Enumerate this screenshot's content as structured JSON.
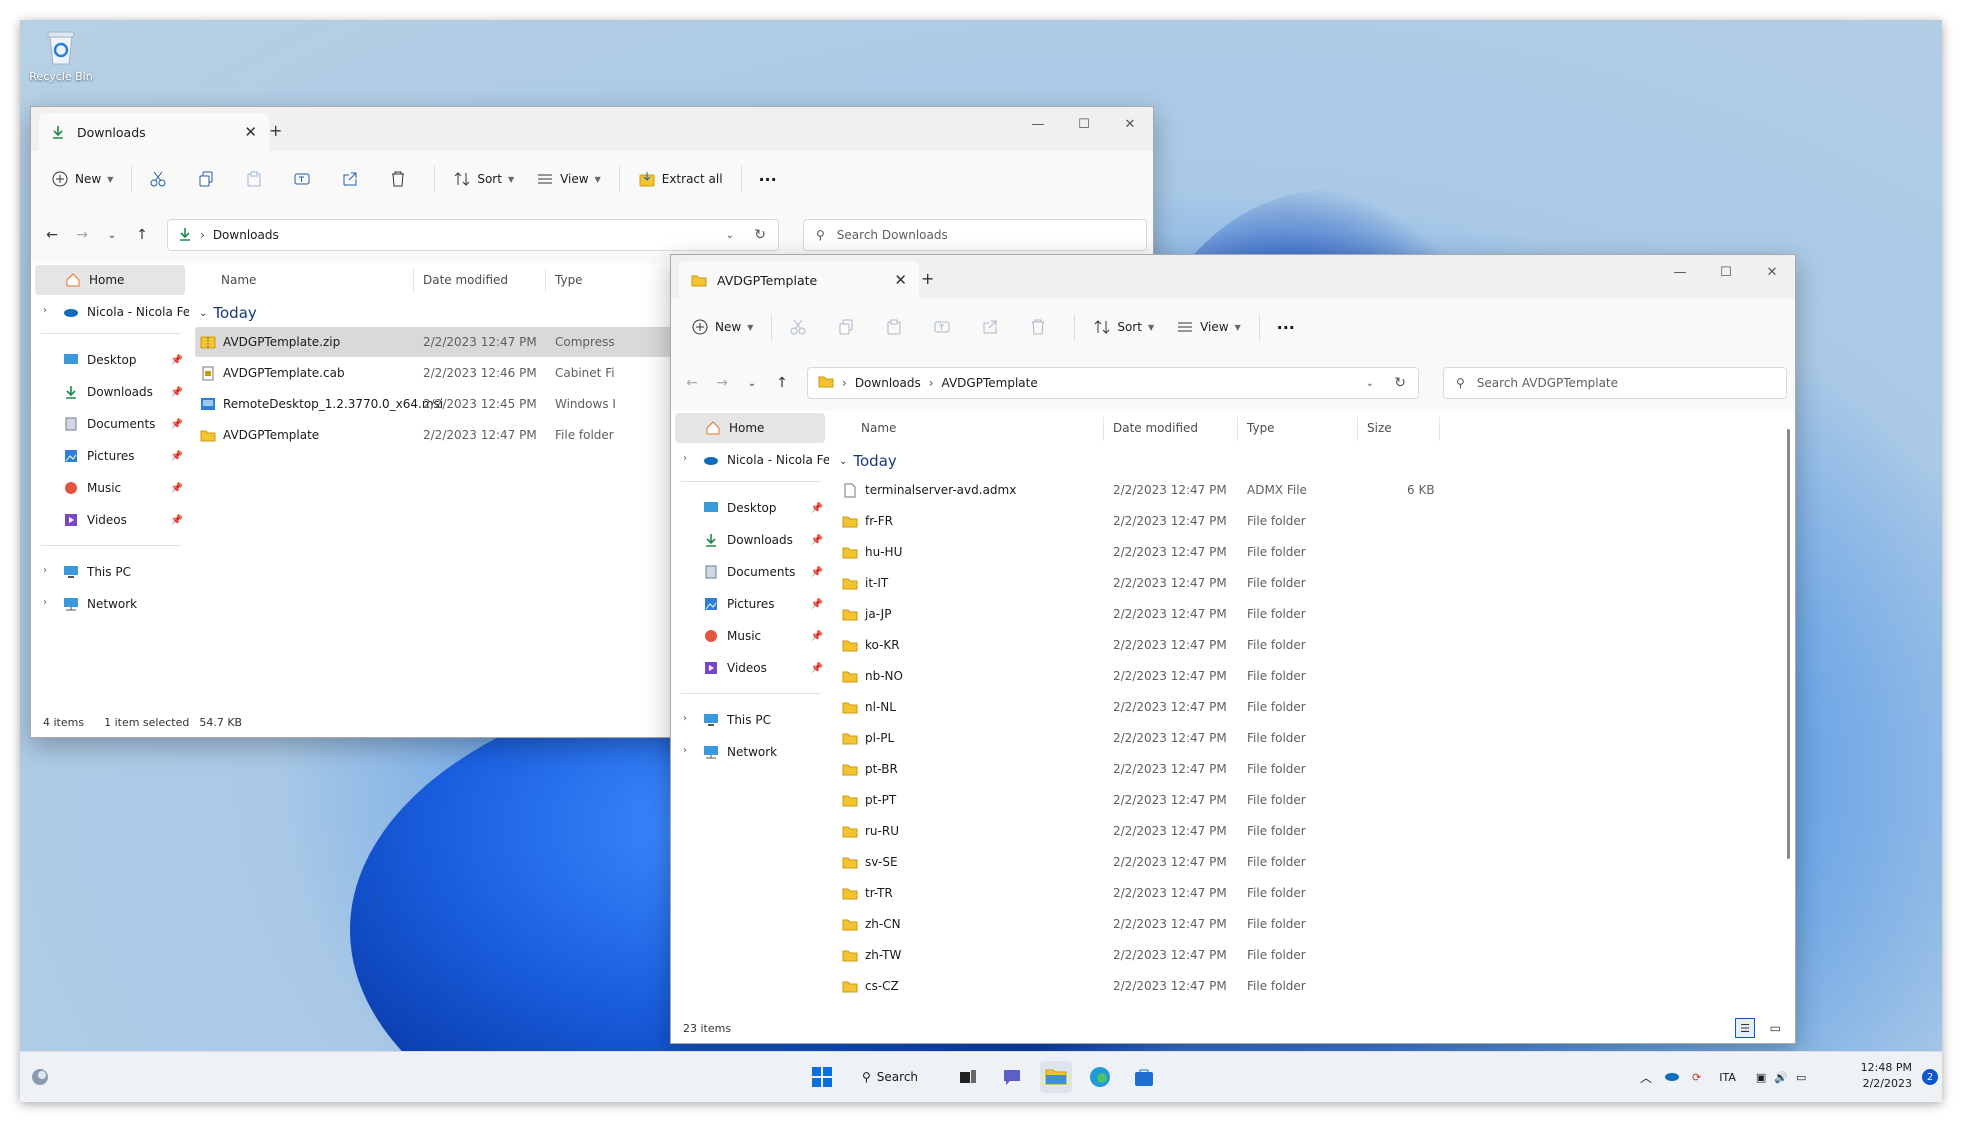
{
  "desktop": {
    "recycle_bin_label": "Recycle Bin"
  },
  "win1": {
    "tab_title": "Downloads",
    "cmd": {
      "new": "New",
      "sort": "Sort",
      "view": "View",
      "extract_all": "Extract all"
    },
    "address": {
      "crumb1": "Downloads"
    },
    "search_placeholder": "Search Downloads",
    "nav": {
      "home": "Home",
      "onedrive": "Nicola - Nicola Ferr",
      "desktop": "Desktop",
      "downloads": "Downloads",
      "documents": "Documents",
      "pictures": "Pictures",
      "music": "Music",
      "videos": "Videos",
      "this_pc": "This PC",
      "network": "Network"
    },
    "columns": {
      "name": "Name",
      "date": "Date modified",
      "type": "Type"
    },
    "group": "Today",
    "files": [
      {
        "name": "AVDGPTemplate.zip",
        "date": "2/2/2023 12:47 PM",
        "type": "Compresse",
        "icon": "zip-folder-icon"
      },
      {
        "name": "AVDGPTemplate.cab",
        "date": "2/2/2023 12:46 PM",
        "type": "Cabinet Fil",
        "icon": "cab-file-icon"
      },
      {
        "name": "RemoteDesktop_1.2.3770.0_x64.msi",
        "date": "2/2/2023 12:45 PM",
        "type": "Windows I",
        "icon": "msi-file-icon"
      },
      {
        "name": "AVDGPTemplate",
        "date": "2/2/2023 12:47 PM",
        "type": "File folder",
        "icon": "folder-icon"
      }
    ],
    "status": {
      "count": "4 items",
      "selected": "1 item selected",
      "size": "54.7 KB"
    }
  },
  "win2": {
    "tab_title": "AVDGPTemplate",
    "cmd": {
      "new": "New",
      "sort": "Sort",
      "view": "View"
    },
    "address": {
      "crumb1": "Downloads",
      "crumb2": "AVDGPTemplate"
    },
    "search_placeholder": "Search AVDGPTemplate",
    "nav": {
      "home": "Home",
      "onedrive": "Nicola - Nicola Ferr",
      "desktop": "Desktop",
      "downloads": "Downloads",
      "documents": "Documents",
      "pictures": "Pictures",
      "music": "Music",
      "videos": "Videos",
      "this_pc": "This PC",
      "network": "Network"
    },
    "columns": {
      "name": "Name",
      "date": "Date modified",
      "type": "Type",
      "size": "Size"
    },
    "group": "Today",
    "files": [
      {
        "name": "terminalserver-avd.admx",
        "date": "2/2/2023 12:47 PM",
        "type": "ADMX File",
        "size": "6 KB"
      },
      {
        "name": "fr-FR",
        "date": "2/2/2023 12:47 PM",
        "type": "File folder",
        "size": ""
      },
      {
        "name": "hu-HU",
        "date": "2/2/2023 12:47 PM",
        "type": "File folder",
        "size": ""
      },
      {
        "name": "it-IT",
        "date": "2/2/2023 12:47 PM",
        "type": "File folder",
        "size": ""
      },
      {
        "name": "ja-JP",
        "date": "2/2/2023 12:47 PM",
        "type": "File folder",
        "size": ""
      },
      {
        "name": "ko-KR",
        "date": "2/2/2023 12:47 PM",
        "type": "File folder",
        "size": ""
      },
      {
        "name": "nb-NO",
        "date": "2/2/2023 12:47 PM",
        "type": "File folder",
        "size": ""
      },
      {
        "name": "nl-NL",
        "date": "2/2/2023 12:47 PM",
        "type": "File folder",
        "size": ""
      },
      {
        "name": "pl-PL",
        "date": "2/2/2023 12:47 PM",
        "type": "File folder",
        "size": ""
      },
      {
        "name": "pt-BR",
        "date": "2/2/2023 12:47 PM",
        "type": "File folder",
        "size": ""
      },
      {
        "name": "pt-PT",
        "date": "2/2/2023 12:47 PM",
        "type": "File folder",
        "size": ""
      },
      {
        "name": "ru-RU",
        "date": "2/2/2023 12:47 PM",
        "type": "File folder",
        "size": ""
      },
      {
        "name": "sv-SE",
        "date": "2/2/2023 12:47 PM",
        "type": "File folder",
        "size": ""
      },
      {
        "name": "tr-TR",
        "date": "2/2/2023 12:47 PM",
        "type": "File folder",
        "size": ""
      },
      {
        "name": "zh-CN",
        "date": "2/2/2023 12:47 PM",
        "type": "File folder",
        "size": ""
      },
      {
        "name": "zh-TW",
        "date": "2/2/2023 12:47 PM",
        "type": "File folder",
        "size": ""
      },
      {
        "name": "cs-CZ",
        "date": "2/2/2023 12:47 PM",
        "type": "File folder",
        "size": ""
      }
    ],
    "status": {
      "count": "23 items"
    }
  },
  "taskbar": {
    "search_label": "Search",
    "language": "ITA",
    "time": "12:48 PM",
    "date": "2/2/2023",
    "notification_count": "2"
  },
  "colors": {
    "accent": "#0b57d0",
    "folder": "#f4c430",
    "group_header": "#1a3a7a"
  }
}
